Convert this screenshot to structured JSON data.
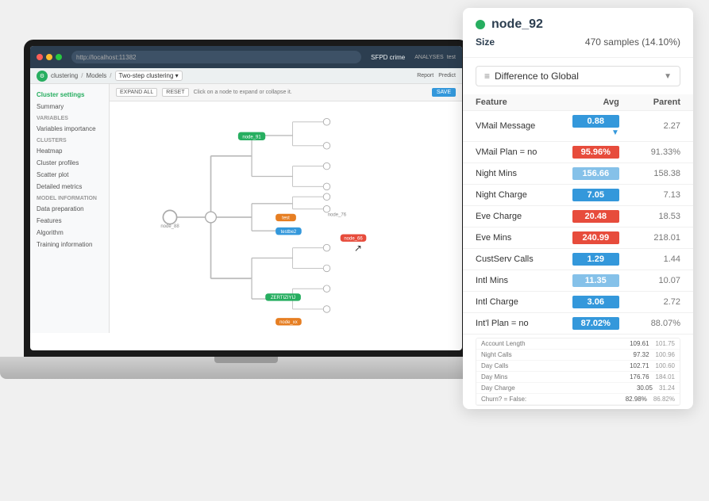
{
  "laptop": {
    "url": "http://localhost:11382",
    "app_title": "SFPD crime",
    "nav_item": "ANALYSES",
    "nav_right": "test"
  },
  "breadcrumb": {
    "icon": "⚙",
    "item1": "clustering",
    "sep1": "/",
    "item2": "Models",
    "sep2": "/",
    "dropdown": "Two-step clustering ▾",
    "action1": "Report",
    "action2": "Predict"
  },
  "sidebar": {
    "active_item": "Cluster settings",
    "items": [
      {
        "label": "Cluster settings",
        "active": true
      },
      {
        "label": "Summary",
        "active": false
      }
    ],
    "sections": [
      {
        "title": "VARIABLES",
        "items": [
          "Variables importance"
        ]
      },
      {
        "title": "CLUSTERS",
        "items": [
          "Heatmap",
          "Cluster profiles",
          "Scatter plot",
          "Detailed metrics"
        ]
      },
      {
        "title": "MODEL INFORMATION",
        "items": [
          "Data preparation",
          "Features",
          "Algorithm",
          "Training information"
        ]
      }
    ]
  },
  "toolbar": {
    "expand_all": "EXPAND ALL",
    "reset": "RESET",
    "hint": "Click on a node to expand or collapse it.",
    "save": "SAVE"
  },
  "panel": {
    "node_name": "node_92",
    "node_color": "#27ae60",
    "size_label": "Size",
    "size_value": "470 samples (14.10%)",
    "dropdown_label": "Difference to Global",
    "dropdown_icon": "≡",
    "table": {
      "headers": [
        "Feature",
        "Avg",
        "Parent"
      ],
      "rows": [
        {
          "feature": "VMail Message",
          "avg": "0.88",
          "bar_type": "blue",
          "parent": "2.27",
          "arrow": true
        },
        {
          "feature": "VMail Plan = no",
          "avg": "95.96%",
          "bar_type": "red",
          "parent": "91.33%"
        },
        {
          "feature": "Night Mins",
          "avg": "156.66",
          "bar_type": "light-blue",
          "parent": "158.38"
        },
        {
          "feature": "Night Charge",
          "avg": "7.05",
          "bar_type": "blue",
          "parent": "7.13"
        },
        {
          "feature": "Eve Charge",
          "avg": "20.48",
          "bar_type": "red",
          "parent": "18.53"
        },
        {
          "feature": "Eve Mins",
          "avg": "240.99",
          "bar_type": "red",
          "parent": "218.01"
        },
        {
          "feature": "CustServ Calls",
          "avg": "1.29",
          "bar_type": "blue",
          "parent": "1.44"
        },
        {
          "feature": "Intl Mins",
          "avg": "11.35",
          "bar_type": "light-blue",
          "parent": "10.07"
        },
        {
          "feature": "Intl Charge",
          "avg": "3.06",
          "bar_type": "blue",
          "parent": "2.72"
        },
        {
          "feature": "Int'l Plan = no",
          "avg": "87.02%",
          "bar_type": "blue",
          "parent": "88.07%"
        }
      ]
    },
    "mini_table": {
      "rows": [
        {
          "label": "Account Length",
          "val": "109.61",
          "val2": "101.75"
        },
        {
          "label": "Night Calls",
          "val": "97.32",
          "val2": "100.96"
        },
        {
          "label": "Day Calls",
          "val": "102.71",
          "val2": "100.60"
        },
        {
          "label": "Day Mins",
          "val": "176.76",
          "val2": "184.01"
        },
        {
          "label": "Day Charge",
          "val": "30.05",
          "val2": "31.24"
        },
        {
          "label": "Churn? = False:",
          "val": "82.98%",
          "val2": "86.82%"
        }
      ]
    }
  }
}
